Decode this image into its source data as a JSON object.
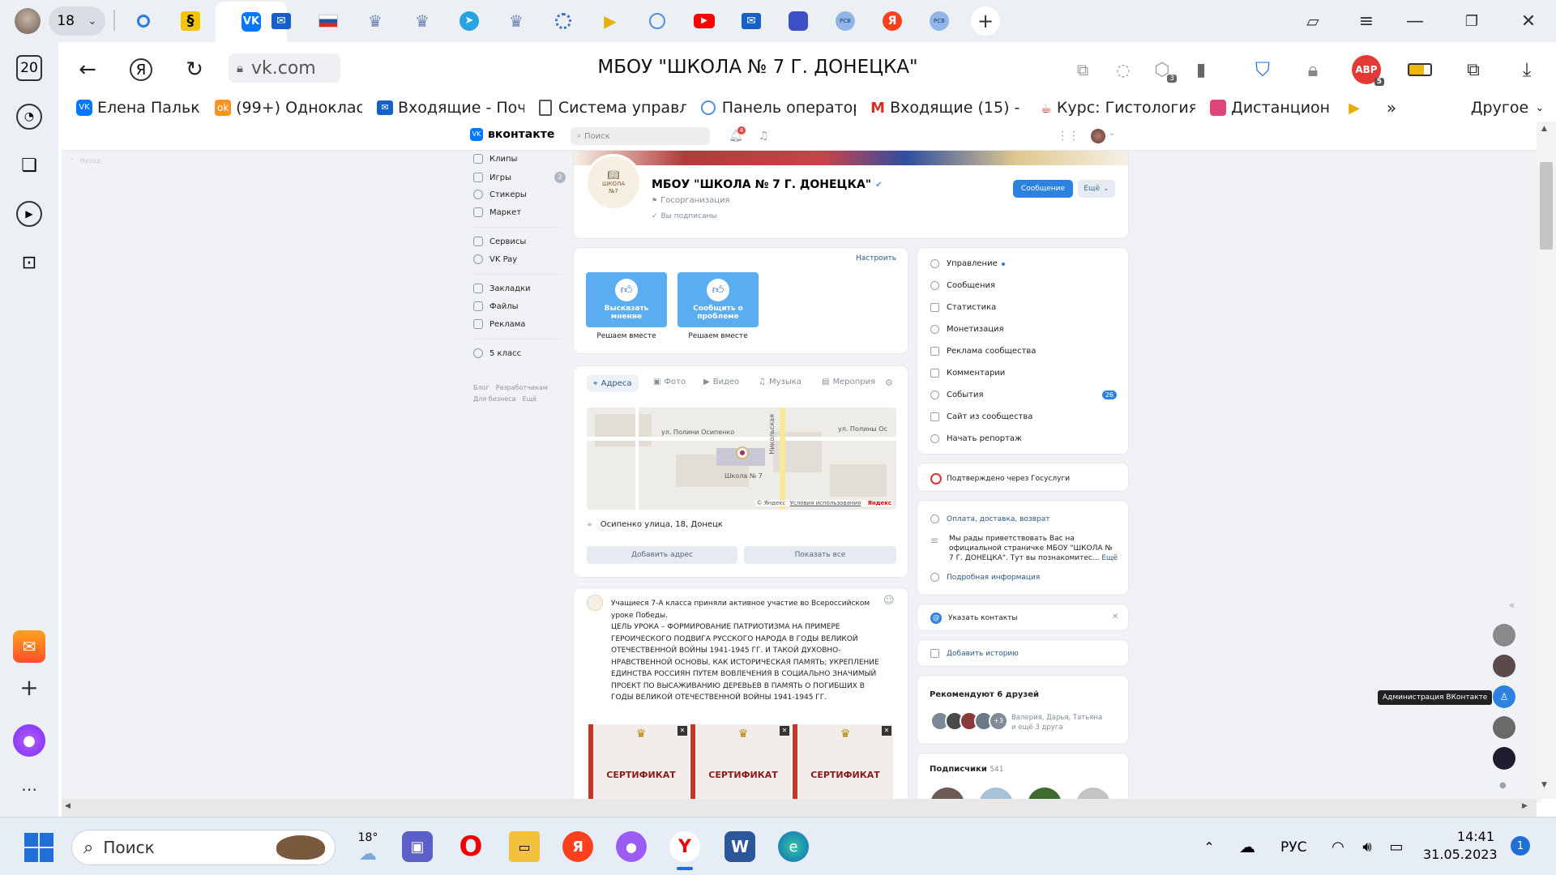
{
  "browser": {
    "tab_count": "18",
    "url": "vk.com",
    "page_title": "МБОУ \"ШКОЛА № 7 Г. ДОНЕЦКА\"",
    "ext_badge_count": "3",
    "abp_badge": "5",
    "sidebar_badge": "20"
  },
  "bookmarks": [
    {
      "label": "Елена Палько"
    },
    {
      "label": "(99+) Одноклассн"
    },
    {
      "label": "Входящие - Почта"
    },
    {
      "label": "Система управлен"
    },
    {
      "label": "Панель оператора"
    },
    {
      "label": "Входящие (15) - р"
    },
    {
      "label": "Курс: Гистология,"
    },
    {
      "label": "Дистанцион"
    }
  ],
  "bookmarks_other": "Другое",
  "vk": {
    "logo": "вконтакте",
    "search_placeholder": "Поиск",
    "notif_count": "4",
    "left_hint": "Назад",
    "nav": [
      {
        "label": "Клипы"
      },
      {
        "label": "Игры",
        "badge": "2"
      },
      {
        "label": "Стикеры"
      },
      {
        "label": "Маркет"
      },
      {
        "label": "Сервисы"
      },
      {
        "label": "VK Pay"
      },
      {
        "label": "Закладки"
      },
      {
        "label": "Файлы"
      },
      {
        "label": "Реклама"
      },
      {
        "label": "5 класс"
      }
    ],
    "footer_links": [
      "Блог",
      "Разработчикам",
      "Для бизнеса",
      "Ещё"
    ],
    "group": {
      "avatar_text": "ШКОЛА №7",
      "name": "МБОУ \"ШКОЛА № 7 Г. ДОНЕЦКА\"",
      "type": "Госорганизация",
      "subscribed": "Вы подписаны",
      "message_button": "Сообщение",
      "more_button": "Ещё"
    },
    "widgets": {
      "settings_link": "Настроить",
      "items": [
        {
          "title": "Высказать мнение",
          "caption": "Решаем вместе"
        },
        {
          "title": "Сообщить о проблеме",
          "caption": "Решаем вместе"
        }
      ]
    },
    "media_tabs": [
      {
        "label": "Адреса"
      },
      {
        "label": "Фото"
      },
      {
        "label": "Видео"
      },
      {
        "label": "Музыка"
      },
      {
        "label": "Мероприя"
      }
    ],
    "map": {
      "street1": "ул. Полини Осипенко",
      "street2": "Никольская",
      "street3": "ул. Полины Ос",
      "school_label": "Школа № 7",
      "copyright": "© Яндекс",
      "terms": "Условия использования",
      "brand": "Яндекс"
    },
    "address": "Осипенко улица, 18, Донецк",
    "add_address_button": "Добавить адрес",
    "show_all_button": "Показать все",
    "post": {
      "text": "Учащиеся 7-А класса приняли активное участие во Всероссийском уроке Победы.\nЦЕЛЬ УРОКА – ФОРМИРОВАНИЕ ПАТРИОТИЗМА НА ПРИМЕРЕ ГЕРОИЧЕСКОГО ПОДВИГА РУССКОГО НАРОДА В ГОДЫ ВЕЛИКОЙ ОТЕЧЕСТВЕННОЙ ВОЙНЫ 1941-1945 ГГ. И ТАКОЙ ДУХОВНО-НРАВСТВЕННОЙ ОСНОВЫ, КАК ИСТОРИЧЕСКАЯ ПАМЯТЬ; УКРЕПЛЕНИЕ ЕДИНСТВА РОССИЯН ПУТЕМ ВОВЛЕЧЕНИЯ В СОЦИАЛЬНО ЗНАЧИМЫЙ ПРОЕКТ ПО ВЫСАЖИВАНИЮ ДЕРЕВЬЕВ В ПАМЯТЬ О ПОГИБШИХ В ГОДЫ ВЕЛИКОЙ ОТЕЧЕСТВЕННОЙ ВОЙНЫ 1941-1945 ГГ.",
      "cert_label": "СЕРТИФИКАТ"
    },
    "manage_menu": [
      {
        "label": "Управление"
      },
      {
        "label": "Сообщения"
      },
      {
        "label": "Статистика"
      },
      {
        "label": "Монетизация"
      },
      {
        "label": "Реклама сообщества"
      },
      {
        "label": "Комментарии"
      },
      {
        "label": "События",
        "badge": "26"
      },
      {
        "label": "Сайт из сообщества"
      },
      {
        "label": "Начать репортаж"
      }
    ],
    "gosuslugi": "Подтверждено через Госуслуги",
    "info": {
      "payment": "Оплата, доставка, возврат",
      "text": "Мы рады приветствовать Вас на официальной страничке МБОУ \"ШКОЛА № 7 Г. ДОНЕЦКА\". Тут вы познакомитес...",
      "more": "Ещё",
      "details": "Подробная информация"
    },
    "contacts": "Указать контакты",
    "story": "Добавить историю",
    "recommend_title": "Рекомендуют 6 друзей",
    "recommend_more": "+3",
    "recommend_names": "Валерия, Дарья, Татьяна",
    "recommend_more_text": "и ещё 3 друга",
    "subscribers_label": "Подписчики",
    "subscribers_count": "541",
    "tooltip": "Администрация ВКонтакте"
  },
  "taskbar": {
    "search": "Поиск",
    "weather": "18°",
    "lang": "РУС",
    "time": "14:41",
    "date": "31.05.2023",
    "notif": "1"
  }
}
